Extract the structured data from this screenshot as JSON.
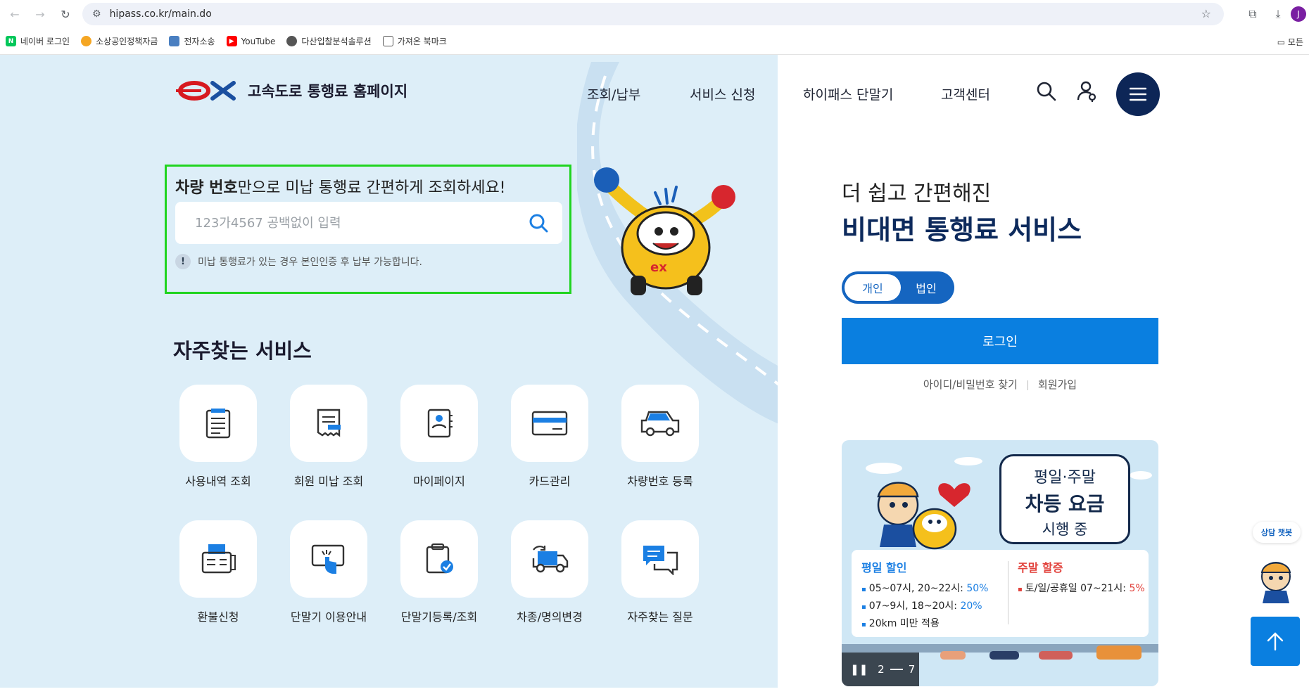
{
  "browser": {
    "url": "hipass.co.kr/main.do",
    "profile_initial": "J"
  },
  "bookmarks": {
    "items": [
      {
        "label": "네이버 로그인",
        "color": "#03c75a",
        "glyph": "N"
      },
      {
        "label": "소상공인정책자금",
        "color": "#f5a623",
        "glyph": "●"
      },
      {
        "label": "전자소송",
        "color": "#4a7fc1",
        "glyph": "◆"
      },
      {
        "label": "YouTube",
        "color": "#ff0000",
        "glyph": "▶"
      },
      {
        "label": "다산입찰분석솔루션",
        "color": "#555555",
        "glyph": "◎"
      },
      {
        "label": "가져온 북마크",
        "color": "#ffffff",
        "glyph": ""
      }
    ],
    "all_label": "모든"
  },
  "header": {
    "logo_text": "고속도로 통행료 홈페이지",
    "nav": [
      "조회/납부",
      "서비스 신청",
      "하이패스 단말기",
      "고객센터"
    ]
  },
  "search": {
    "title_bold": "차량 번호",
    "title_rest": "만으로 미납 통행료 간편하게 조회하세요!",
    "placeholder": "123가4567 공백없이 입력",
    "notice": "미납 통행료가 있는 경우 본인인증 후 납부 가능합니다."
  },
  "faq": {
    "title": "자주찾는 서비스",
    "items": [
      {
        "label": "사용내역 조회",
        "icon": "document-list-icon"
      },
      {
        "label": "회원 미납 조회",
        "icon": "receipt-icon"
      },
      {
        "label": "마이페이지",
        "icon": "profile-card-icon"
      },
      {
        "label": "카드관리",
        "icon": "credit-card-icon"
      },
      {
        "label": "차량번호 등록",
        "icon": "car-icon"
      },
      {
        "label": "환불신청",
        "icon": "fax-machine-icon"
      },
      {
        "label": "단말기 이용안내",
        "icon": "touch-screen-icon"
      },
      {
        "label": "단말기등록/조회",
        "icon": "clipboard-check-icon"
      },
      {
        "label": "차종/명의변경",
        "icon": "truck-swap-icon"
      },
      {
        "label": "자주찾는 질문",
        "icon": "chat-bubbles-icon"
      }
    ]
  },
  "panel": {
    "subtitle": "더 쉽고 간편해진",
    "title": "비대면 통행료 서비스",
    "toggle_on": "개인",
    "toggle_off": "법인",
    "login": "로그인",
    "find": "아이디/비밀번호 찾기",
    "join": "회원가입"
  },
  "banner": {
    "bubble_l1": "평일·주말",
    "bubble_l2": "차등 요금",
    "bubble_l3": "시행 중",
    "weekday_head": "평일 할인",
    "weekday_rows": [
      {
        "text": "05~07시, 20~22시:",
        "value": "50%"
      },
      {
        "text": "07~9시, 18~20시:",
        "value": "20%"
      },
      {
        "text": "20km 미만 적용",
        "value": ""
      }
    ],
    "weekend_head": "주말 할증",
    "weekend_rows": [
      {
        "text": "토/일/공휴일 07~21시:",
        "value": "5%"
      }
    ],
    "slide_current": "2",
    "slide_total": "7"
  },
  "floating": {
    "chatbot_label": "상담 챗봇"
  },
  "colors": {
    "accent": "#0a7fe0",
    "navy": "#0d2657",
    "highlight_border": "#20d420"
  }
}
